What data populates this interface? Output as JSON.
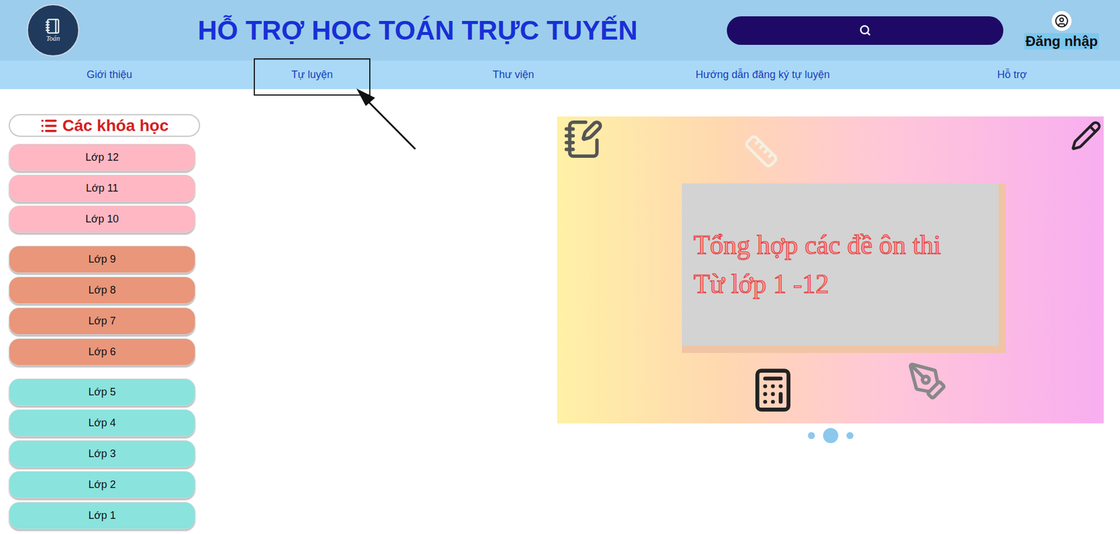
{
  "header": {
    "logo": {
      "text": "Toán"
    },
    "title": "HỖ TRỢ HỌC TOÁN TRỰC TUYẾN",
    "login": "Đăng nhập"
  },
  "nav": [
    {
      "label": "Giới thiệu",
      "selected": false
    },
    {
      "label": "Tự luyện",
      "selected": true
    },
    {
      "label": "Thư viện",
      "selected": false
    },
    {
      "label": "Hướng dẫn đăng ký tự luyện",
      "selected": false
    },
    {
      "label": "Hỗ trợ",
      "selected": false
    }
  ],
  "sidebar": {
    "title": "Các khóa học",
    "groups": [
      {
        "color": "#ffb7c3",
        "items": [
          "Lớp 12",
          "Lớp 11",
          "Lớp 10"
        ]
      },
      {
        "color": "#e9967a",
        "items": [
          "Lớp 9",
          "Lớp 8",
          "Lớp 7",
          "Lớp 6"
        ]
      },
      {
        "color": "#8ae3dd",
        "items": [
          "Lớp 5",
          "Lớp 4",
          "Lớp 3",
          "Lớp 2",
          "Lớp 1"
        ]
      }
    ]
  },
  "banner": {
    "lines": [
      "Tổng hợp các đề ôn thi",
      "Từ lớp 1 -12"
    ]
  },
  "carousel": [
    {
      "selected": false
    },
    {
      "selected": true
    },
    {
      "selected": false
    }
  ]
}
